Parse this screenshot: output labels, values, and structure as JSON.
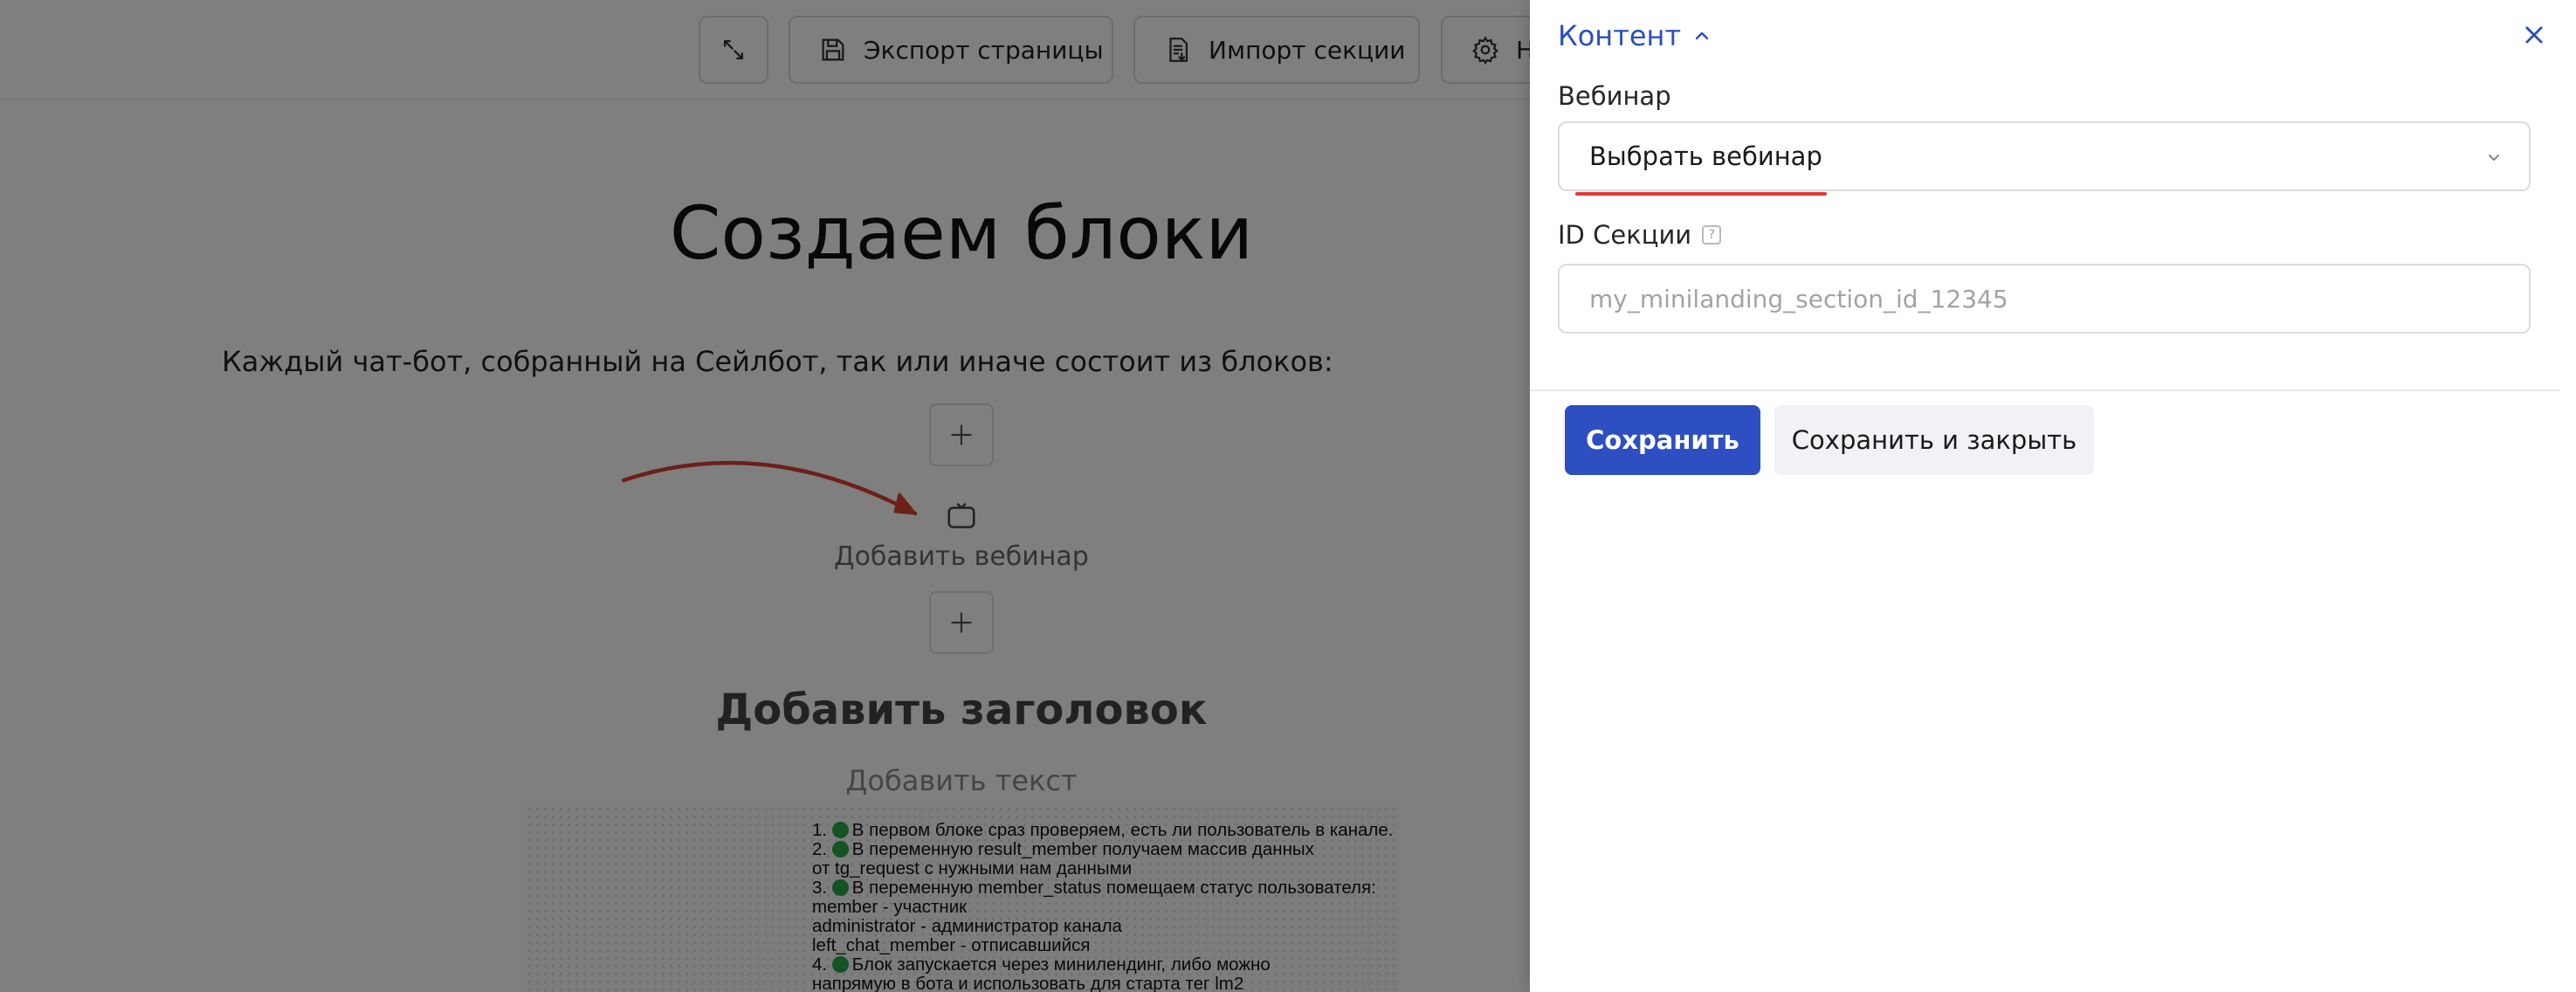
{
  "toolbar": {
    "export_label": "Экспорт страницы",
    "import_label": "Импорт секции",
    "settings_label": "На"
  },
  "editor": {
    "title": "Создаем блоки",
    "intro": "Каждый чат-бот, собранный на Сейлбот, так или иначе состоит из блоков:",
    "add_webinar": "Добавить вебинар",
    "add_heading": "Добавить заголовок",
    "add_text": "Добавить текст",
    "image_lines": [
      "1. 🟢 В первом блоке сраз проверяем, есть ли пользователь в канале.",
      "2. 🟢 В переменную result_member получаем массив данных",
      "от tg_request с нужными нам данными",
      "3. 🟢 В переменную member_status помещаем статус пользователя:",
      "member - участник",
      "administrator - администратор канала",
      "left_chat_member - отписавшийся",
      "4. 🟢 Блок запускается через минилендинг, либо можно",
      "напрямую в бота и использовать для старта тег lm2"
    ]
  },
  "panel": {
    "header": "Контент",
    "webinar_label": "Вебинар",
    "webinar_select_value": "Выбрать вебинар",
    "section_id_label": "ID Секции",
    "help_mark": "?",
    "section_id_placeholder": "my_minilanding_section_id_12345",
    "section_id_value": "",
    "save_label": "Сохранить",
    "save_close_label": "Сохранить и закрыть"
  },
  "colors": {
    "accent": "#2d4fc1",
    "header_link": "#2b4fbf",
    "underline_red": "#e03a3a",
    "arrow_red": "#d9412e",
    "overlay": "rgba(0,0,0,0.5)"
  }
}
